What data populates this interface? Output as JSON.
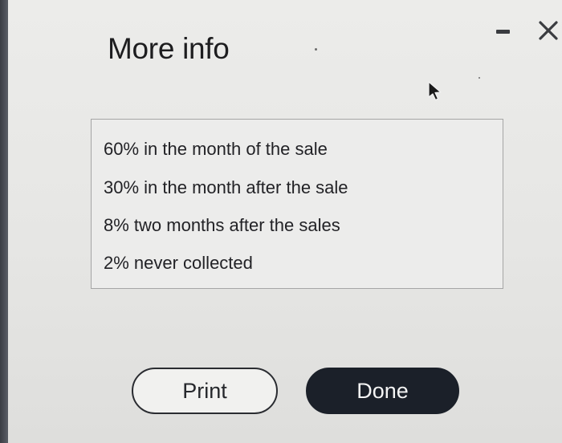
{
  "dialog": {
    "title": "More info",
    "window_controls": {
      "minimize_icon": "minus-icon",
      "close_icon": "close-x-icon"
    }
  },
  "info": {
    "lines": [
      "60% in the month of the sale",
      "30% in the month after the sale",
      "8% two months after the sales",
      "2% never collected"
    ]
  },
  "buttons": {
    "print_label": "Print",
    "done_label": "Done"
  },
  "colors": {
    "done_background": "#1b2029",
    "done_text": "#f4f4f4",
    "print_border": "#2a2c31",
    "box_border": "#a5a5a5",
    "dialog_background": "#e8e8e6"
  },
  "pointer": {
    "icon": "mouse-pointer-icon"
  }
}
